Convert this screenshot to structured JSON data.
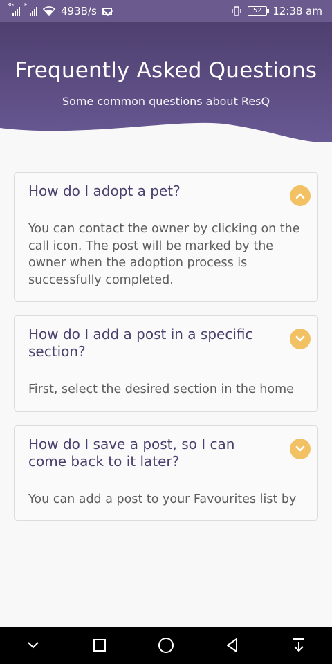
{
  "status_bar": {
    "net_label": "3G",
    "e_label": "E",
    "speed": "493B/s",
    "battery": "52",
    "time": "12:38 am"
  },
  "header": {
    "title": "Frequently Asked Questions",
    "subtitle": "Some common questions about ResQ"
  },
  "faqs": [
    {
      "question": "How do I adopt a pet?",
      "answer": "You can contact the owner by clicking on the call icon. The post will be marked by the owner when the adoption process is successfully completed.",
      "expanded": true,
      "toggle_icon": "chevron-up-icon"
    },
    {
      "question": "How do I add a post in a specific section?",
      "answer": "First, select the desired section in the home",
      "expanded": false,
      "toggle_icon": "chevron-down-icon"
    },
    {
      "question": "How do I save a post, so I can come back to it later?",
      "answer": "You can add a post to your Favourites list by",
      "expanded": false,
      "toggle_icon": "chevron-down-icon"
    }
  ],
  "nav_bar": {
    "buttons": [
      "chevron-down-icon",
      "square-icon",
      "circle-icon",
      "triangle-back-icon",
      "notification-pull-icon"
    ]
  },
  "colors": {
    "header_top": "#4e3f6f",
    "header_bottom": "#6a5a95",
    "accent": "#f2c163",
    "question_text": "#4b3f6e",
    "answer_text": "#5d5d5d"
  }
}
